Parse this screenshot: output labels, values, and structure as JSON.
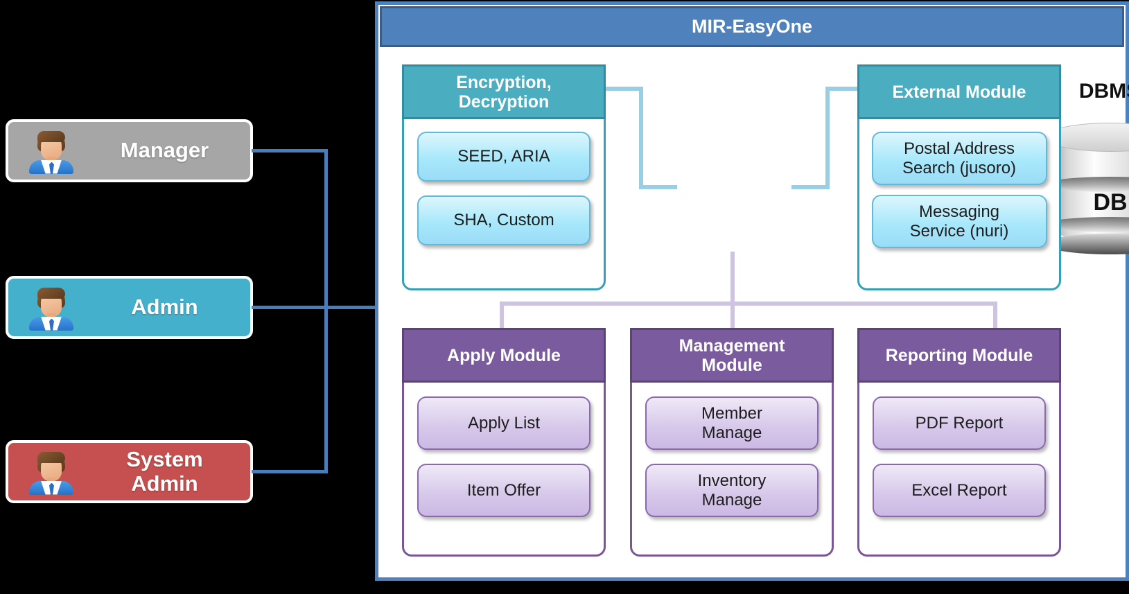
{
  "app": {
    "title": "MIR-EasyOne",
    "colors": {
      "header_blue": "#4f81bd",
      "header_border": "#385d8a",
      "teal": "#4aadc0",
      "purple": "#7a5c9e",
      "manager_gray": "#a6a6a6",
      "admin_teal": "#45b0cb",
      "system_admin_red": "#c5504f",
      "connector_blue": "#4a7ebb"
    }
  },
  "actors": [
    {
      "id": "manager",
      "label": "Manager",
      "icon": "businessman-icon",
      "color": "#a6a6a6"
    },
    {
      "id": "admin",
      "label": "Admin",
      "icon": "businessman-icon",
      "color": "#45b0cb"
    },
    {
      "id": "system-admin",
      "label": "System\nAdmin",
      "icon": "businessman-icon",
      "color": "#c5504f"
    }
  ],
  "database": {
    "label": "DBMS",
    "cylinder_label": "DB",
    "icon": "database-cylinder-icon"
  },
  "modules": [
    {
      "id": "encryption",
      "title": "Encryption,\nDecryption",
      "theme": "teal",
      "items": [
        {
          "label": "SEED, ARIA"
        },
        {
          "label": "SHA, Custom"
        }
      ]
    },
    {
      "id": "external",
      "title": "External Module",
      "theme": "teal",
      "items": [
        {
          "label": "Postal Address\nSearch (jusoro)"
        },
        {
          "label": "Messaging\nService (nuri)"
        }
      ]
    },
    {
      "id": "apply",
      "title": "Apply Module",
      "theme": "purple",
      "items": [
        {
          "label": "Apply List"
        },
        {
          "label": "Item Offer"
        }
      ]
    },
    {
      "id": "management",
      "title": "Management\nModule",
      "theme": "purple",
      "items": [
        {
          "label": "Member\nManage"
        },
        {
          "label": "Inventory\nManage"
        }
      ]
    },
    {
      "id": "reporting",
      "title": "Reporting Module",
      "theme": "purple",
      "items": [
        {
          "label": "PDF Report"
        },
        {
          "label": "Excel Report"
        }
      ]
    }
  ]
}
